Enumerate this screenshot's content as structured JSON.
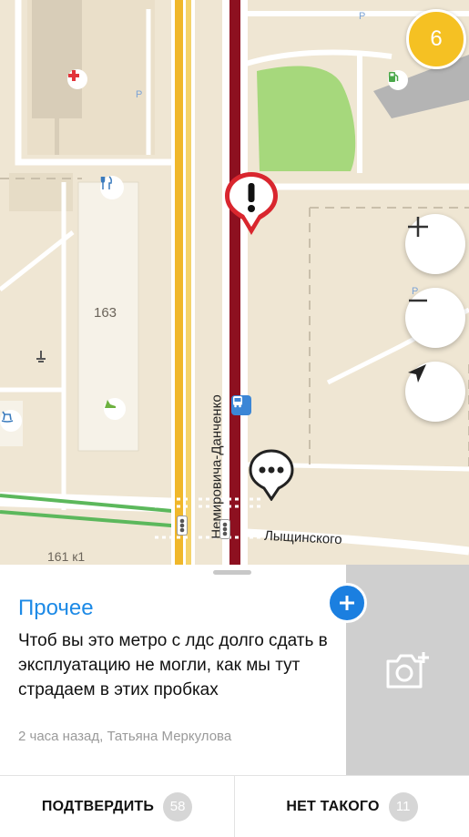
{
  "map": {
    "cluster_count": "6",
    "building_number": "163",
    "building_number_2": "161 к1",
    "street_vertical": "Немировича-Данченко",
    "street_horizontal": "Лыщинского",
    "icons": [
      "hospital-icon",
      "parking-icon",
      "fuel-station-icon",
      "restaurant-icon",
      "bus-stop-icon",
      "traffic-light-icon",
      "warning-pin-icon",
      "comment-pin-icon",
      "playground-icon",
      "shoe-shop-icon",
      "monument-icon"
    ],
    "controls": {
      "zoom_in": "zoom-in-icon",
      "zoom_out": "zoom-out-icon",
      "locate": "navigation-arrow-icon"
    },
    "colors": {
      "traffic_red": "#8d1020",
      "road_yellow": "#f0b72a",
      "tram_green": "#5cb85c",
      "park_green": "#a6d87c"
    }
  },
  "event": {
    "category": "Прочее",
    "comment": "Чтоб вы это метро с лдс долго сдать в эксплуатацию не могли, как мы тут страдаем в этих пробках",
    "meta": "2 часа назад, Татьяна Меркулова",
    "accent_color": "#1d8ae6"
  },
  "actions": {
    "confirm_label": "ПОДТВЕРДИТЬ",
    "confirm_count": "58",
    "deny_label": "НЕТ ТАКОГО",
    "deny_count": "11"
  }
}
